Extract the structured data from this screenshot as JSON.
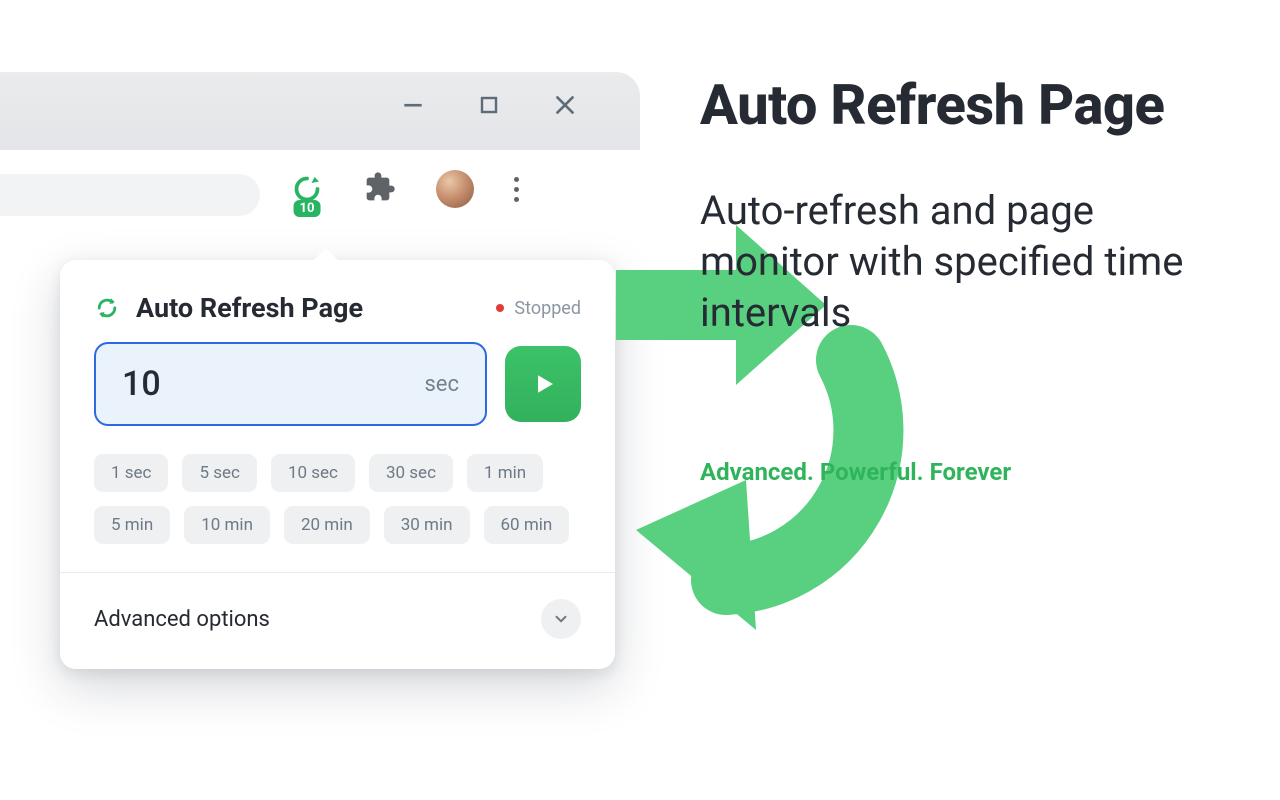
{
  "browser": {
    "ext_badge": "10"
  },
  "popup": {
    "title": "Auto Refresh Page",
    "status_label": "Stopped",
    "interval_value": "10",
    "interval_unit": "sec",
    "presets": [
      "1 sec",
      "5 sec",
      "10 sec",
      "30 sec",
      "1 min",
      "5 min",
      "10 min",
      "20 min",
      "30 min",
      "60 min"
    ],
    "advanced_label": "Advanced options"
  },
  "marketing": {
    "title": "Auto Refresh Page",
    "subtitle": "Auto-refresh and page monitor with specified time intervals",
    "tagline": "Advanced. Powerful. Forever"
  }
}
